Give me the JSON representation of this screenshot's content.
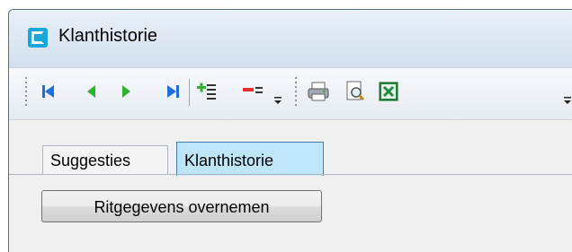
{
  "window": {
    "title": "Klanthistorie"
  },
  "toolbar": {
    "buttons": [
      {
        "icon": "first-record-icon"
      },
      {
        "icon": "previous-record-icon"
      },
      {
        "icon": "next-record-icon"
      },
      {
        "icon": "last-record-icon"
      },
      {
        "icon": "add-record-icon"
      },
      {
        "icon": "delete-record-icon"
      },
      {
        "icon": "print-icon"
      },
      {
        "icon": "print-preview-icon"
      },
      {
        "icon": "excel-export-icon"
      }
    ]
  },
  "tabs": [
    {
      "label": "Suggesties",
      "active": false
    },
    {
      "label": "Klanthistorie",
      "active": true
    }
  ],
  "actions": {
    "copy_ride_data_label": "Ritgegevens overnemen"
  },
  "colors": {
    "accent": "#1aa6d8",
    "active_tab": "#bfe6f8",
    "nav_blue": "#1e6fd9",
    "nav_green": "#2db32d"
  }
}
